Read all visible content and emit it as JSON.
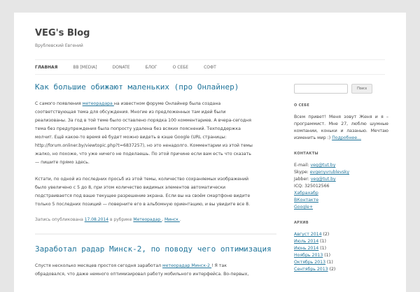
{
  "site": {
    "title": "VEG's Blog",
    "description": "Врублевский Евгений"
  },
  "nav": [
    "ГЛАВНАЯ",
    "BB [MEDIA]",
    "DONATE",
    "БЛОГ",
    "О СЕБЕ",
    "СОФТ"
  ],
  "posts": [
    {
      "title": "Как большие обижают маленьких (про Онлайнер)",
      "p1_pre": "С самого появления ",
      "p1_link": "метеорадара ",
      "p1_post": " на известном форуме Онлайнер была создана",
      "p1_lines": [
        "соответствующая тема для обсуждения. Многие из предложенных там идей были",
        "реализованы. За год в той теме было оставлено порядка 100 комментариев. А вчера-сегодня",
        "тема без предупреждения была попросту удалена без всяких пояснений. Техподдержка",
        "молчит. Ещё какое-то время её будет можно видеть в кэше Google (URL страницы:",
        "http://forum.onliner.by/viewtopic.php?t=6837257), но это ненадолго. Комментарии из этой темы",
        "жалко, но похоже, что уже ничего не поделаешь. По этой причине если вам есть что сказать",
        "— пишите прямо здесь."
      ],
      "p2_lines": [
        "Кстати, по одной из последних просьб из этой темы, количество сохраняемых изображений",
        "было увеличено с 5 до 8, при этом количество видимых элементов автоматически",
        "подстраивается под ваше текущее разрешение экрана. Если вы на своём смартфоне видите",
        "только 5 последних позиций — поверните его в альбомную ориентацию, и вы увидите все 8."
      ],
      "meta_pre": "Запись опубликована ",
      "meta_date": "17.08.2014",
      "meta_mid": " в рубрике ",
      "meta_cat1": "Метеорадар ",
      "meta_sep": ", ",
      "meta_cat2": "Минск ",
      "meta_end": "."
    },
    {
      "title": "Заработал радар Минск-2, по поводу чего оптимизация",
      "p1_pre": "Спустя несколько месяцев простоя сегодня заработал ",
      "p1_link": "метеорадар Минск-2 ",
      "p1_post": "! Я так",
      "p1_lines": [
        "обрадовался, что даже немного оптимизировал работу мобильного интерфейса. Во-первых,"
      ]
    }
  ],
  "sidebar": {
    "search_button": "Поиск",
    "about_title": "О СЕБЕ",
    "about_text": "Всем привет! Меня зовут Женя и я – программист. Мне 27, люблю шумные компании, коньки и лазанью. Мечтаю изменить мир :) ",
    "about_more": "Подробнее...",
    "contacts_title": "КОНТАКТЫ",
    "contacts": [
      {
        "label": "E-mail: ",
        "value": "veg@tut.by"
      },
      {
        "label": "Skype: ",
        "value": "evgenyvrublevsky"
      },
      {
        "label": "Jabber: ",
        "value": "veg@tut.by"
      },
      {
        "label": "ICQ: 325012566",
        "value": ""
      }
    ],
    "links": [
      "Хабрахабр",
      "ВКонтакте",
      "Google+"
    ],
    "archive_title": "АРХИВ",
    "archive": [
      {
        "month": "Август 2014",
        "count": " (2)"
      },
      {
        "month": "Июль 2014",
        "count": " (1)"
      },
      {
        "month": "Июнь 2014",
        "count": " (1)"
      },
      {
        "month": "Ноябрь 2013",
        "count": " (1)"
      },
      {
        "month": "Октябрь 2013",
        "count": " (1)"
      },
      {
        "month": "Сентябрь 2013",
        "count": " (2)"
      }
    ]
  }
}
